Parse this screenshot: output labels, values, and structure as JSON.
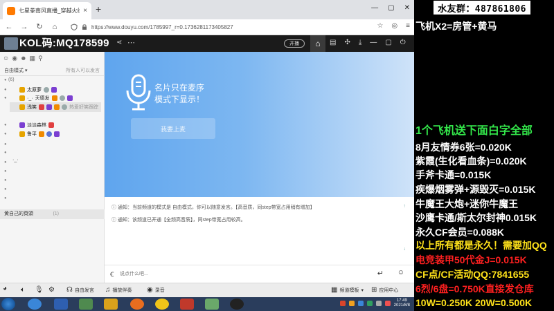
{
  "browser": {
    "tab_title": "七星拳南风直播_穿越火线直播",
    "tab_close": "×",
    "new_tab": "+",
    "window_controls": [
      "—",
      "▢",
      "✕"
    ],
    "nav": {
      "back": "←",
      "forward": "→",
      "reload": "↻"
    },
    "url": "https://www.douyu.com/1785997_r=0.1736281173405827"
  },
  "header": {
    "kol_text": "KOL码:MQ178599",
    "broadcast_label": "开播"
  },
  "left_panel": {
    "mode_label": "自由模式",
    "mode_right": "所有人可以发言",
    "channel_header": "(6)",
    "users": [
      {
        "name": "太原萝"
      },
      {
        "name": "天德发"
      },
      {
        "name": "浅笑"
      },
      {
        "name": "热爱好笑跟踪"
      },
      {
        "name": "淡淡森林"
      },
      {
        "name": "鲁平"
      }
    ],
    "face_glyph": "·_·",
    "bottom_row": "黄自己的頁頭",
    "bottom_count": "(1)"
  },
  "main": {
    "message": "名片只在麦序模式下显示！",
    "button_label": "我要上麦"
  },
  "chat": {
    "lines": [
      "通知：当前频道的模式是 自由模式，你可以随意发言。【高音质，同step带宽占用稍有增加】",
      "通知：该频道已开通【全频高音质】，同step带宽占用较高。"
    ],
    "input_placeholder": "说点什么吧..."
  },
  "toolbar": {
    "free_talk": "自由发言",
    "play_music": "播放伴奏",
    "record": "录音",
    "channel_settings": "频道模板",
    "app_center": "应用中心"
  },
  "overlay": {
    "qq_group": "水友群：487861806",
    "lines": [
      {
        "text": "飞机X2=房管+黄马",
        "color": "white"
      },
      {
        "text": "1个飞机送下面白字全部",
        "color": "green"
      },
      {
        "text": "8月友情券6张=0.020K",
        "color": "white"
      },
      {
        "text": "紫霞(生化看血条)=0.020K",
        "color": "white"
      },
      {
        "text": "手斧卡通=0.015K",
        "color": "white"
      },
      {
        "text": "疾爆烟雾弹+源毁灭=0.015K",
        "color": "white"
      },
      {
        "text": "牛魔王大炮+迷你牛魔王",
        "color": "white"
      },
      {
        "text": "沙鹰卡通/斯太尔封神0.015K",
        "color": "white"
      },
      {
        "text": "永久CF会员=0.088K",
        "color": "white"
      },
      {
        "text": "以上所有都是永久！需要加QQ",
        "color": "yellow"
      },
      {
        "text": "电竞装甲50代金J=0.015K",
        "color": "red"
      },
      {
        "text": "CF点/CF活动QQ:7841655",
        "color": "yellow"
      },
      {
        "text": "6烈/6盘=0.750K直接发仓库",
        "color": "red"
      },
      {
        "text": "10W=0.250K 20W=0.500K",
        "color": "yellow"
      }
    ]
  },
  "taskbar": {
    "time": "17:49",
    "date": "2021/8/8"
  },
  "colors": {
    "main_gradient_start": "#5fa5ee",
    "overlay_green": "#33e64a",
    "overlay_yellow": "#ffe21a",
    "overlay_red": "#ff2020"
  }
}
